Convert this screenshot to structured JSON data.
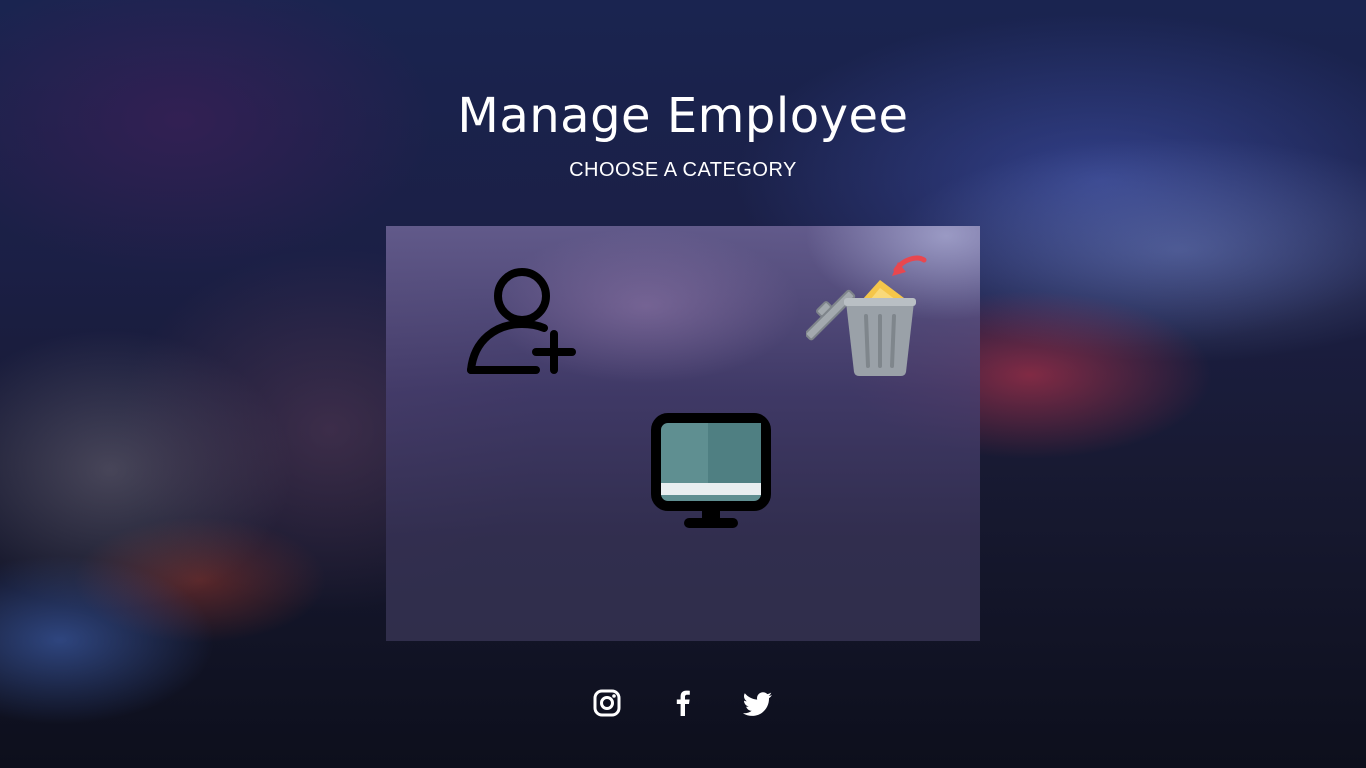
{
  "header": {
    "title": "Manage Employee",
    "subtitle": "CHOOSE A CATEGORY"
  },
  "categories": [
    {
      "name": "add-employee",
      "icon": "user-plus-icon"
    },
    {
      "name": "delete-employee",
      "icon": "trash-can-icon"
    },
    {
      "name": "view-employees",
      "icon": "monitor-icon"
    }
  ],
  "social": [
    {
      "name": "instagram",
      "icon": "instagram-icon"
    },
    {
      "name": "facebook",
      "icon": "facebook-icon"
    },
    {
      "name": "twitter",
      "icon": "twitter-icon"
    }
  ],
  "colors": {
    "text": "#ffffff",
    "icon_dark": "#000000",
    "trash_body": "#9aa1a8",
    "trash_accent": "#f5c64a",
    "arrow": "#e8474f",
    "screen": "#5f8f91"
  }
}
